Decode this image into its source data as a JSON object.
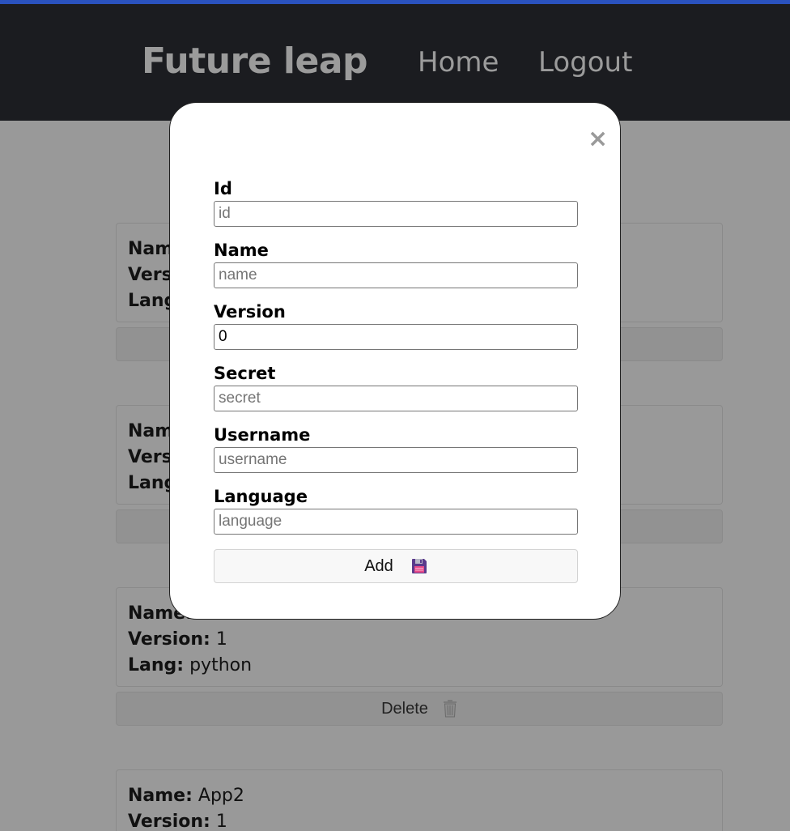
{
  "navbar": {
    "brand": "Future leap",
    "links": [
      {
        "label": "Home"
      },
      {
        "label": "Logout"
      }
    ]
  },
  "apps": [
    {
      "name_label": "Nam",
      "version_label": "Versi",
      "lang_label": "Lang"
    },
    {
      "name_label": "Nam",
      "version_label": "Versi",
      "lang_label": "Lang"
    },
    {
      "name_label": "Name:",
      "name_value": "",
      "version_label": "Version:",
      "version_value": "1",
      "lang_label": "Lang:",
      "lang_value": "python",
      "delete_label": "Delete"
    },
    {
      "name_label": "Name:",
      "name_value": "App2",
      "version_label": "Version:",
      "version_value": "1"
    }
  ],
  "modal": {
    "close_symbol": "×",
    "fields": [
      {
        "label": "Id",
        "placeholder": "id",
        "value": ""
      },
      {
        "label": "Name",
        "placeholder": "name",
        "value": ""
      },
      {
        "label": "Version",
        "placeholder": "",
        "value": "0"
      },
      {
        "label": "Secret",
        "placeholder": "secret",
        "value": ""
      },
      {
        "label": "Username",
        "placeholder": "username",
        "value": ""
      },
      {
        "label": "Language",
        "placeholder": "language",
        "value": ""
      }
    ],
    "add_label": "Add"
  },
  "colors": {
    "accent": "#2a52be",
    "navbar": "#1b1c20",
    "overlay": "#999999",
    "modal": "#ffffff"
  },
  "icons": {
    "close": "close-icon",
    "add": "floppy-disk-icon",
    "delete": "trash-icon"
  }
}
